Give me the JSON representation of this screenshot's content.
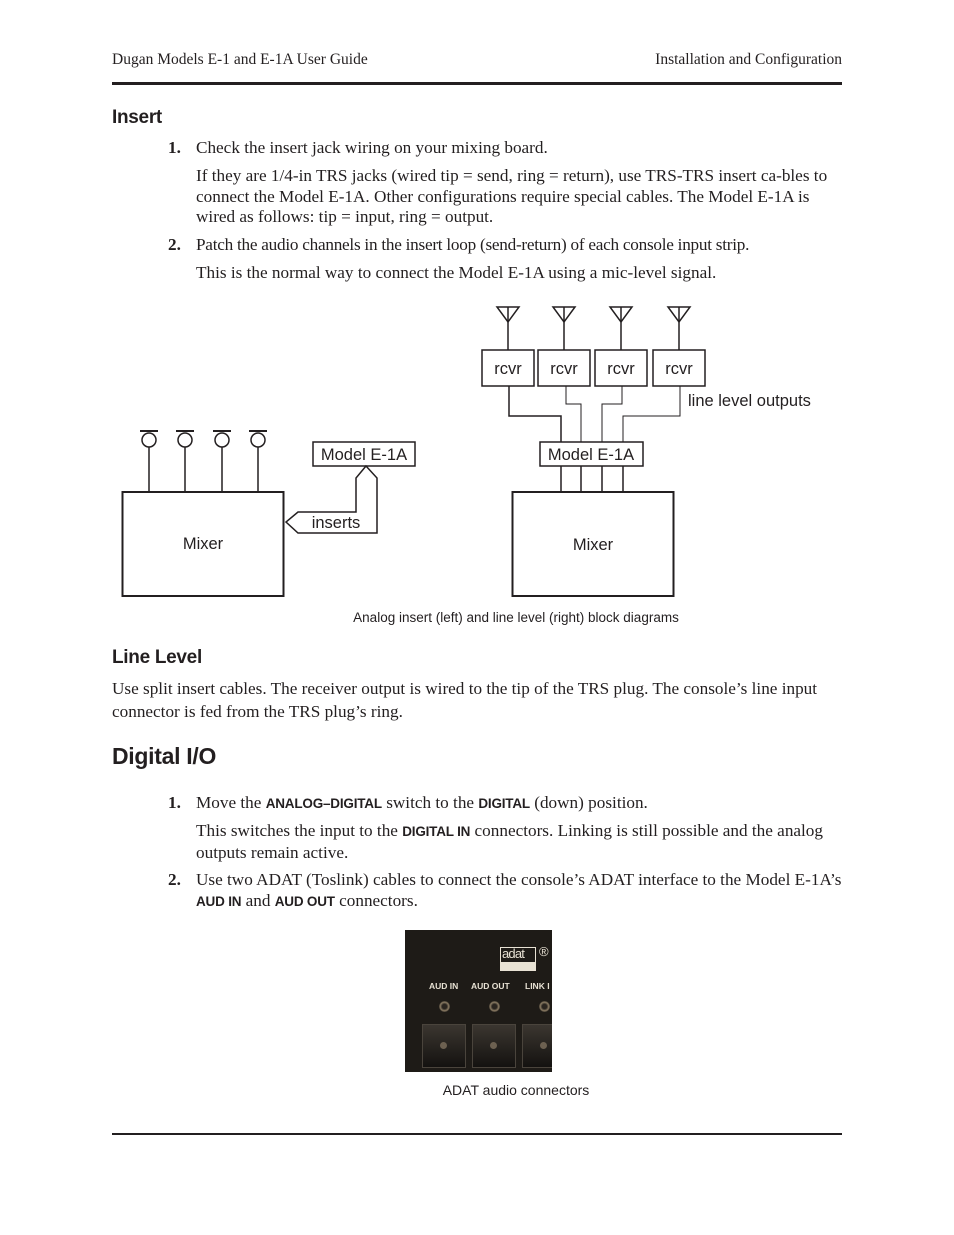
{
  "header": {
    "left": "Dugan Models E-1 and E-1A User Guide",
    "right": "Installation and Configuration"
  },
  "insert": {
    "heading": "Insert",
    "steps": [
      {
        "number": "1.",
        "text": "Check the insert jack wiring on your mixing board.",
        "detail": "If they are 1/4-in TRS jacks (wired tip = send, ring = return), use TRS-TRS insert ca-bles to connect the Model E-1A. Other configurations require special cables. The Model E-1A is wired as follows: tip = input, ring = output."
      },
      {
        "number": "2.",
        "text": "Patch the audio channels in the insert loop (send-return) of each console input strip.",
        "detail": "This is the normal way to connect the Model E-1A using a mic-level signal."
      }
    ]
  },
  "diagram": {
    "left": {
      "mixer_label": "Mixer",
      "device_label": "Model E-1A",
      "inserts_label": "inserts",
      "mic_count": 4
    },
    "right": {
      "mixer_label": "Mixer",
      "device_label": "Model E-1A",
      "receiver_label": "rcvr",
      "receiver_count": 4,
      "outputs_label": "line level outputs"
    },
    "caption": "Analog insert (left) and line level (right) block diagrams"
  },
  "line_level": {
    "heading": "Line Level",
    "text": "Use split insert cables. The receiver output is wired to the tip of the TRS plug. The console’s line input connector is fed from the TRS plug’s ring."
  },
  "digital_io": {
    "heading": "Digital I/O",
    "step1": {
      "number": "1.",
      "t1": "Move the ",
      "k1": "ANALOG–DIGITAL",
      "t2": " switch to the ",
      "k2": "DIGITAL",
      "t3": " (down) position.",
      "d1": "This switches the input to the ",
      "dk": "DIGITAL IN",
      "d2": " connectors. Linking is still possible and the analog outputs remain active."
    },
    "step2": {
      "number": "2.",
      "t1": "Use two ADAT (Toslink) cables to connect the console’s ADAT interface to the Model E-1A’s ",
      "k1": "AUD IN",
      "t2": " and ",
      "k2": "AUD OUT",
      "t3": " connectors."
    },
    "photo": {
      "logo": "adat",
      "registered": "®",
      "labels": [
        "AUD IN",
        "AUD OUT",
        "LINK I"
      ],
      "caption": "ADAT audio connectors"
    }
  }
}
